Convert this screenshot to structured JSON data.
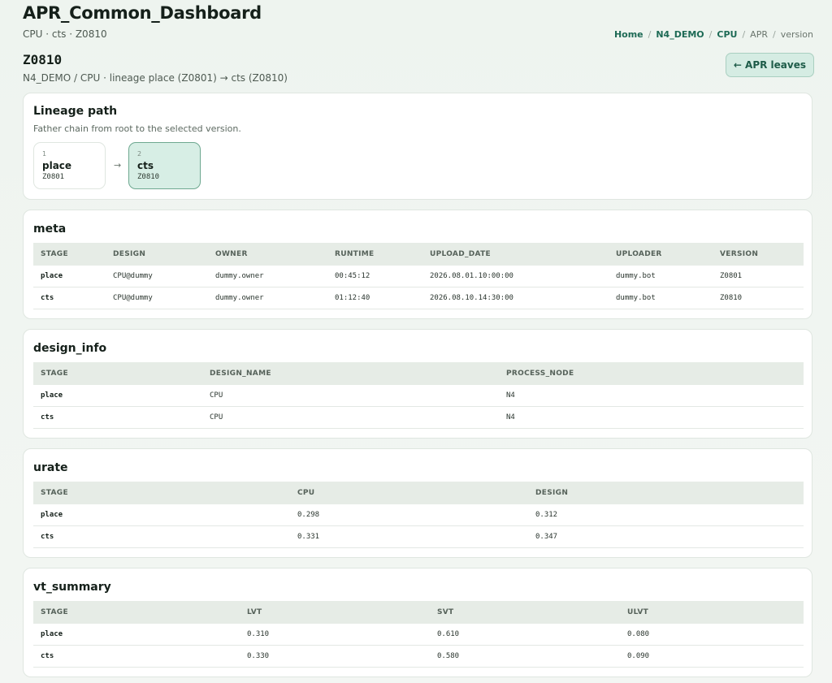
{
  "header": {
    "title": "APR_Common_Dashboard",
    "subtitle": "CPU · cts · Z0810",
    "breadcrumb": [
      "Home",
      "N4_DEMO",
      "CPU",
      "APR",
      "version"
    ]
  },
  "version": {
    "code": "Z0810",
    "lineage_text": "N4_DEMO / CPU · lineage place (Z0801) → cts (Z0810)",
    "back_button": "← APR leaves"
  },
  "lineage": {
    "title": "Lineage path",
    "description": "Father chain from root to the selected version.",
    "arrow": "→",
    "nodes": [
      {
        "index": "1",
        "stage": "place",
        "code": "Z0801"
      },
      {
        "index": "2",
        "stage": "cts",
        "code": "Z0810"
      }
    ]
  },
  "meta": {
    "title": "meta",
    "columns": [
      "STAGE",
      "DESIGN",
      "OWNER",
      "RUNTIME",
      "UPLOAD_DATE",
      "UPLOADER",
      "VERSION"
    ],
    "rows": [
      [
        "place",
        "CPU@dummy",
        "dummy.owner",
        "00:45:12",
        "2026.08.01.10:00:00",
        "dummy.bot",
        "Z0801"
      ],
      [
        "cts",
        "CPU@dummy",
        "dummy.owner",
        "01:12:40",
        "2026.08.10.14:30:00",
        "dummy.bot",
        "Z0810"
      ]
    ]
  },
  "design_info": {
    "title": "design_info",
    "columns": [
      "STAGE",
      "DESIGN_NAME",
      "PROCESS_NODE"
    ],
    "rows": [
      [
        "place",
        "CPU",
        "N4"
      ],
      [
        "cts",
        "CPU",
        "N4"
      ]
    ]
  },
  "urate": {
    "title": "urate",
    "columns": [
      "STAGE",
      "CPU",
      "DESIGN"
    ],
    "rows": [
      [
        "place",
        "0.298",
        "0.312"
      ],
      [
        "cts",
        "0.331",
        "0.347"
      ]
    ]
  },
  "vt_summary": {
    "title": "vt_summary",
    "columns": [
      "STAGE",
      "LVT",
      "SVT",
      "ULVT"
    ],
    "rows": [
      [
        "place",
        "0.310",
        "0.610",
        "0.080"
      ],
      [
        "cts",
        "0.330",
        "0.580",
        "0.090"
      ]
    ]
  }
}
